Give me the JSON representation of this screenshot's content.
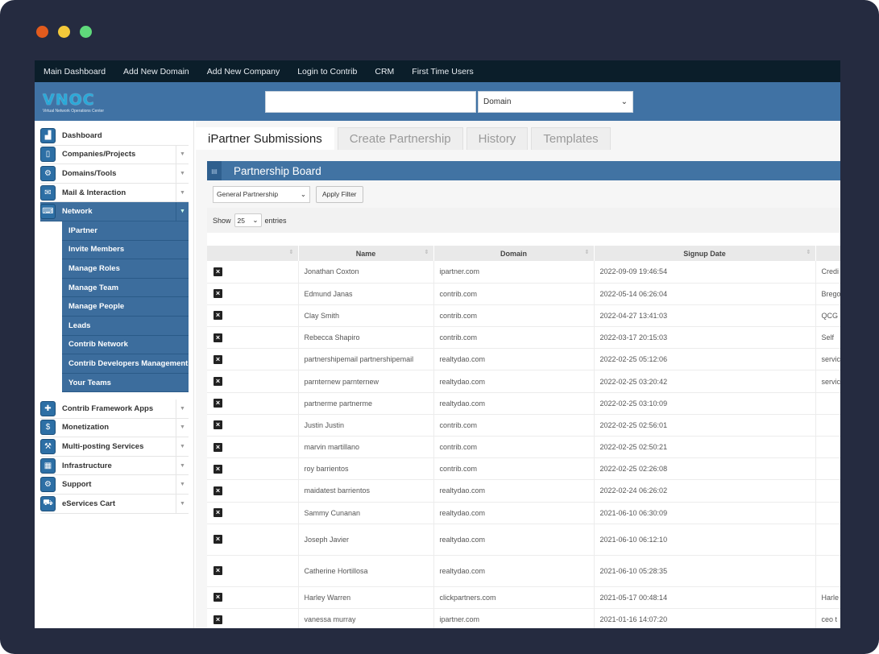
{
  "window": {
    "dots": [
      {
        "name": "close-dot",
        "color": "#e25b1d"
      },
      {
        "name": "minimize-dot",
        "color": "#f4c93a"
      },
      {
        "name": "maximize-dot",
        "color": "#5fd97b"
      }
    ]
  },
  "topnav": [
    "Main Dashboard",
    "Add New Domain",
    "Add New Company",
    "Login to Contrib",
    "CRM",
    "First Time Users"
  ],
  "header": {
    "logo_text": "VNOC",
    "logo_sub": "Virtual Network Operations Center",
    "search_value": "",
    "domain_select": "Domain"
  },
  "sidebar": {
    "top_items": [
      {
        "label": "Dashboard",
        "icon": "chart-icon",
        "glyph": "▟",
        "caret": false
      },
      {
        "label": "Companies/Projects",
        "icon": "phone-icon",
        "glyph": "▯",
        "caret": true
      },
      {
        "label": "Domains/Tools",
        "icon": "gear-icon",
        "glyph": "⚙",
        "caret": true
      },
      {
        "label": "Mail & Interaction",
        "icon": "message-icon",
        "glyph": "✉",
        "caret": true
      },
      {
        "label": "Network",
        "icon": "keyboard-icon",
        "glyph": "⌨",
        "caret": true,
        "active": true
      }
    ],
    "network_sub": [
      "IPartner",
      "Invite Members",
      "Manage Roles",
      "Manage Team",
      "Manage People",
      "Leads",
      "Contrib Network",
      "Contrib Developers Management",
      "Your Teams"
    ],
    "bottom_items": [
      {
        "label": "Contrib Framework Apps",
        "icon": "puzzle-icon",
        "glyph": "✚"
      },
      {
        "label": "Monetization",
        "icon": "dollar-icon",
        "glyph": "$"
      },
      {
        "label": "Multi-posting Services",
        "icon": "hammer-icon",
        "glyph": "⚒"
      },
      {
        "label": "Infrastructure",
        "icon": "grid-icon",
        "glyph": "▦"
      },
      {
        "label": "Support",
        "icon": "cog-icon",
        "glyph": "⚙"
      },
      {
        "label": "eServices Cart",
        "icon": "cart-icon",
        "glyph": "⛟"
      }
    ]
  },
  "tabs": [
    "iPartner Submissions",
    "Create Partnership",
    "History",
    "Templates"
  ],
  "panel": {
    "title": "Partnership Board",
    "filter_select": "General Partnership",
    "apply_label": "Apply Filter",
    "show_label": "Show",
    "show_value": "25",
    "entries_label": "entries"
  },
  "table": {
    "headers": [
      "",
      "Name",
      "Domain",
      "Signup Date",
      ""
    ],
    "rows": [
      {
        "name": "Jonathan Coxton",
        "domain": "ipartner.com",
        "date": "2022-09-09 19:46:54",
        "extra": "Credi"
      },
      {
        "name": "Edmund Janas",
        "domain": "contrib.com",
        "date": "2022-05-14 06:26:04",
        "extra": "Brego"
      },
      {
        "name": "Clay Smith",
        "domain": "contrib.com",
        "date": "2022-04-27 13:41:03",
        "extra": "QCG"
      },
      {
        "name": "Rebecca Shapiro",
        "domain": "contrib.com",
        "date": "2022-03-17 20:15:03",
        "extra": "Self"
      },
      {
        "name": "partnershipemail partnershipemail",
        "domain": "realtydao.com",
        "date": "2022-02-25 05:12:06",
        "extra": "servic"
      },
      {
        "name": "parnternew parnternew",
        "domain": "realtydao.com",
        "date": "2022-02-25 03:20:42",
        "extra": "servic"
      },
      {
        "name": "partnerme partnerme",
        "domain": "realtydao.com",
        "date": "2022-02-25 03:10:09",
        "extra": ""
      },
      {
        "name": "Justin Justin",
        "domain": "contrib.com",
        "date": "2022-02-25 02:56:01",
        "extra": ""
      },
      {
        "name": "marvin martillano",
        "domain": "contrib.com",
        "date": "2022-02-25 02:50:21",
        "extra": ""
      },
      {
        "name": "roy barrientos",
        "domain": "contrib.com",
        "date": "2022-02-25 02:26:08",
        "extra": ""
      },
      {
        "name": "maidatest barrientos",
        "domain": "realtydao.com",
        "date": "2022-02-24 06:26:02",
        "extra": ""
      },
      {
        "name": "Sammy Cunanan",
        "domain": "realtydao.com",
        "date": "2021-06-10 06:30:09",
        "extra": ""
      },
      {
        "name": "Joseph Javier",
        "domain": "realtydao.com",
        "date": "2021-06-10 06:12:10",
        "extra": "",
        "tall": true
      },
      {
        "name": "Catherine Hortillosa",
        "domain": "realtydao.com",
        "date": "2021-06-10 05:28:35",
        "extra": "",
        "tall": true
      },
      {
        "name": "Harley Warren",
        "domain": "clickpartners.com",
        "date": "2021-05-17 00:48:14",
        "extra": "Harle"
      },
      {
        "name": "vanessa murray",
        "domain": "ipartner.com",
        "date": "2021-01-16 14:07:20",
        "extra": "ceo t"
      }
    ]
  }
}
